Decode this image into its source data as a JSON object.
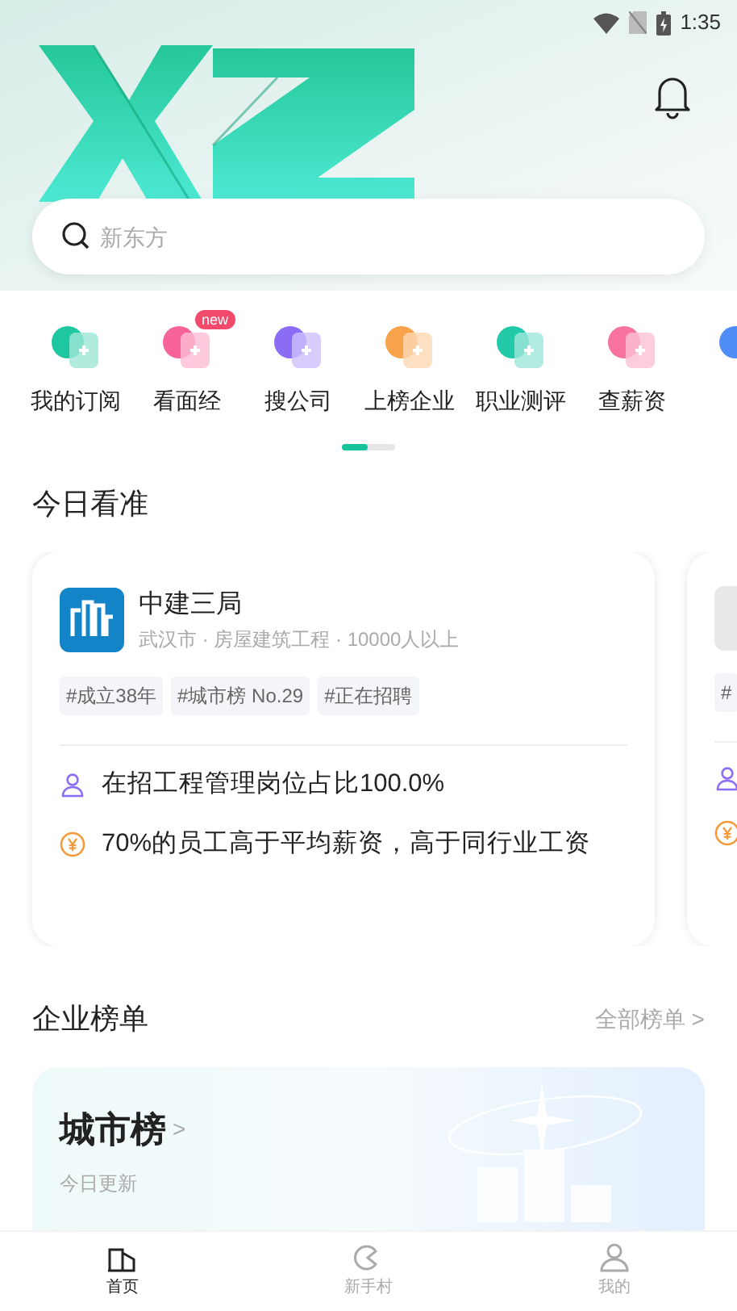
{
  "status_bar": {
    "time": "1:35"
  },
  "search": {
    "placeholder": "新东方"
  },
  "shortcuts": [
    {
      "label": "我的订阅",
      "color": "#1fc7a0"
    },
    {
      "label": "看面经",
      "color": "#f8649a",
      "badge": "new"
    },
    {
      "label": "搜公司",
      "color": "#8b6cf5"
    },
    {
      "label": "上榜企业",
      "color": "#f8a24c"
    },
    {
      "label": "职业测评",
      "color": "#22c9a8"
    },
    {
      "label": "查薪资",
      "color": "#f7729f"
    },
    {
      "color": "#4f8df7"
    }
  ],
  "today": {
    "title": "今日看准",
    "cards": [
      {
        "name": "中建三局",
        "meta": "武汉市 · 房屋建筑工程 · 10000人以上",
        "tags": [
          "#成立38年",
          "#城市榜 No.29",
          "#正在招聘"
        ],
        "facts": [
          {
            "kind": "person",
            "text": "在招工程管理岗位占比100.0%"
          },
          {
            "kind": "salary",
            "text": "70%的员工高于平均薪资，高于同行业工资"
          }
        ]
      },
      {
        "tags": [
          "#"
        ],
        "facts": [
          {
            "kind": "person"
          },
          {
            "kind": "salary"
          }
        ]
      }
    ]
  },
  "rankings": {
    "title": "企业榜单",
    "more": "全部榜单 >",
    "card": {
      "title": "城市榜",
      "arrow": ">",
      "subtitle": "今日更新"
    }
  },
  "tab_bar": [
    {
      "label": "首页",
      "selected": true
    },
    {
      "label": "新手村",
      "selected": false
    },
    {
      "label": "我的",
      "selected": false
    }
  ]
}
